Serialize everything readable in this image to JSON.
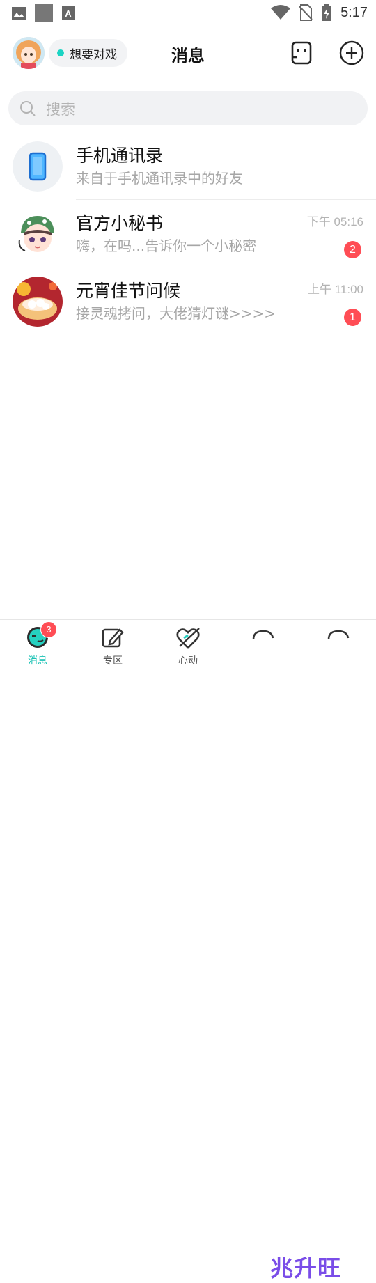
{
  "statusbar": {
    "time": "5:17",
    "left_icons": [
      "image-icon",
      "square-icon",
      "font-icon"
    ],
    "right_icons": [
      "wifi-icon",
      "no-sim-icon",
      "battery-charging-icon"
    ]
  },
  "header": {
    "status_label": "想要对戏",
    "status_color": "#1bd4c4",
    "title": "消息"
  },
  "search": {
    "placeholder": "搜索"
  },
  "conversations": [
    {
      "name": "手机通讯录",
      "preview": "来自于手机通讯录中的好友",
      "time": "",
      "unread": ""
    },
    {
      "name": "官方小秘书",
      "preview": "嗨，在吗...告诉你一个小秘密",
      "time": "下午 05:16",
      "unread": "2"
    },
    {
      "name": "元宵佳节问候",
      "preview": "接灵魂拷问，大佬猜灯谜>>>>",
      "time": "上午 11:00",
      "unread": "1"
    }
  ],
  "tabbar": {
    "tabs": [
      {
        "label": "消息",
        "badge": "3",
        "active": true,
        "icon": "message-bubble-icon"
      },
      {
        "label": "专区",
        "badge": "",
        "active": false,
        "icon": "edit-icon"
      },
      {
        "label": "心动",
        "badge": "",
        "active": false,
        "icon": "heart-arrow-icon"
      },
      {
        "label": "",
        "badge": "",
        "active": false,
        "icon": "partial-icon"
      },
      {
        "label": "",
        "badge": "",
        "active": false,
        "icon": "partial-icon"
      }
    ],
    "watermark": "兆升旺"
  },
  "colors": {
    "accent": "#1bc2b4",
    "badge": "#ff4d55"
  }
}
